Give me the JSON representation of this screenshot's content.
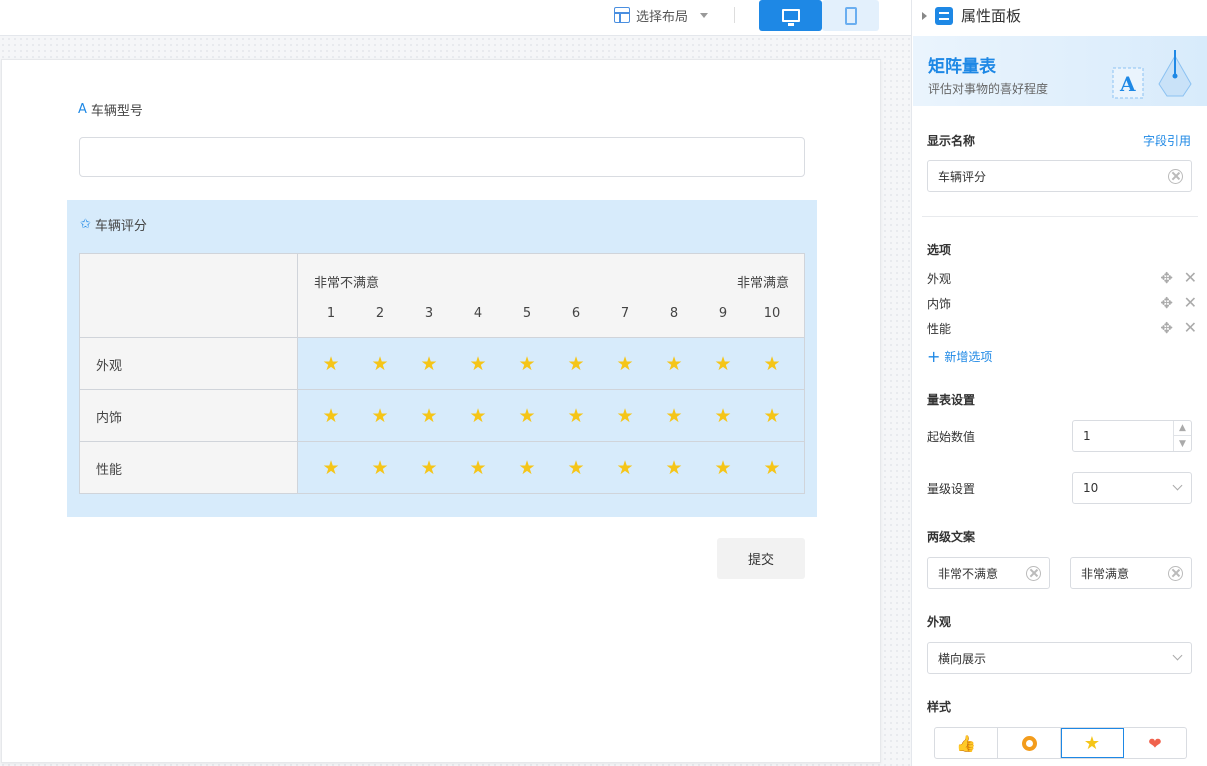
{
  "toolbar": {
    "layout_label": "选择布局"
  },
  "form": {
    "field1_label": "车辆型号",
    "field2_label": "车辆评分",
    "matrix": {
      "low_label": "非常不满意",
      "high_label": "非常满意",
      "scale": [
        "1",
        "2",
        "3",
        "4",
        "5",
        "6",
        "7",
        "8",
        "9",
        "10"
      ],
      "rows": [
        "外观",
        "内饰",
        "性能"
      ]
    },
    "submit_label": "提交"
  },
  "panel": {
    "title": "属性面板",
    "banner_title": "矩阵量表",
    "banner_subtitle": "评估对事物的喜好程度",
    "display_name_label": "显示名称",
    "field_ref_link": "字段引用",
    "display_name_value": "车辆评分",
    "options_label": "选项",
    "options": [
      "外观",
      "内饰",
      "性能"
    ],
    "add_option": "新增选项",
    "scale_settings_label": "量表设置",
    "start_value_label": "起始数值",
    "start_value": "1",
    "level_label": "量级设置",
    "level_value": "10",
    "two_level_label": "两级文案",
    "low_text": "非常不满意",
    "high_text": "非常满意",
    "appearance_label": "外观",
    "appearance_value": "横向展示",
    "style_label": "样式",
    "style_options": [
      "thumb-icon",
      "ring-icon",
      "star-icon",
      "heart-icon"
    ],
    "style_selected": "star-icon"
  },
  "colors": {
    "accent": "#1e88e5",
    "star": "#f5c518",
    "matrix_bg": "#d7ebfb"
  }
}
